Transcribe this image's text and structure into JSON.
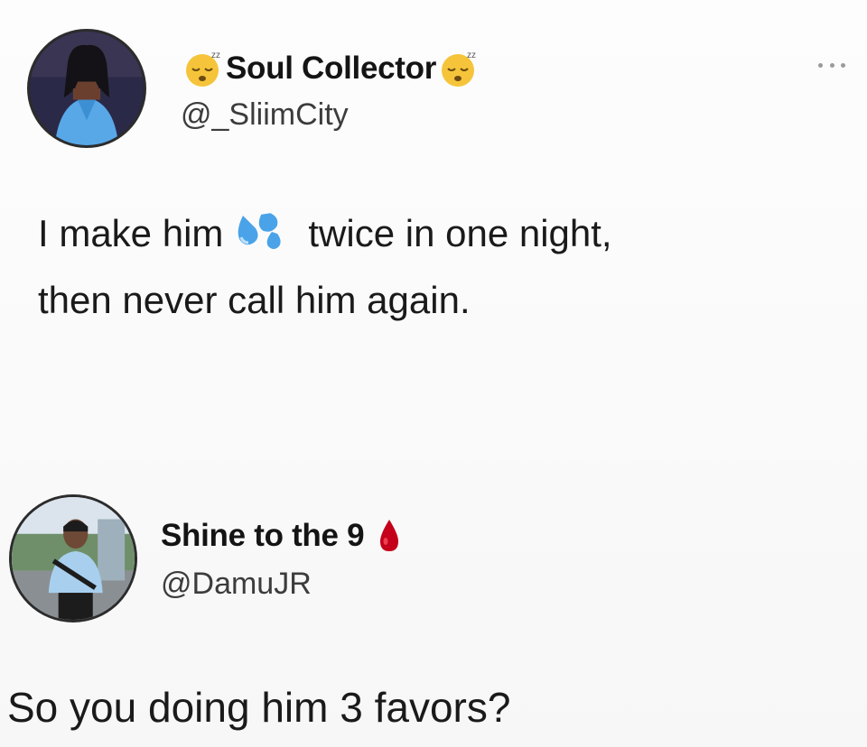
{
  "tweet": {
    "author": {
      "display_name": "Soul Collector",
      "handle": "@_SliimCity",
      "avatar": "profile-photo",
      "name_emoji": "sleeping-face-emoji"
    },
    "text_before_emoji": "I make him",
    "text_emoji": "sweat-droplets-emoji",
    "text_after_emoji": "twice in one night,",
    "text_line2": "then never call him again.",
    "more_icon": "more-horizontal-icon"
  },
  "reply": {
    "author": {
      "display_name": "Shine to the 9",
      "handle": "@DamuJR",
      "avatar": "profile-photo",
      "name_emoji": "drop-of-blood-emoji"
    },
    "text": "So you doing him 3 favors?"
  },
  "colors": {
    "background": "#fbfbfb",
    "text": "#1a1a1a",
    "handle": "#3c3c3c",
    "sweat_blue": "#4aa3e8",
    "blood_red": "#c4001a"
  }
}
